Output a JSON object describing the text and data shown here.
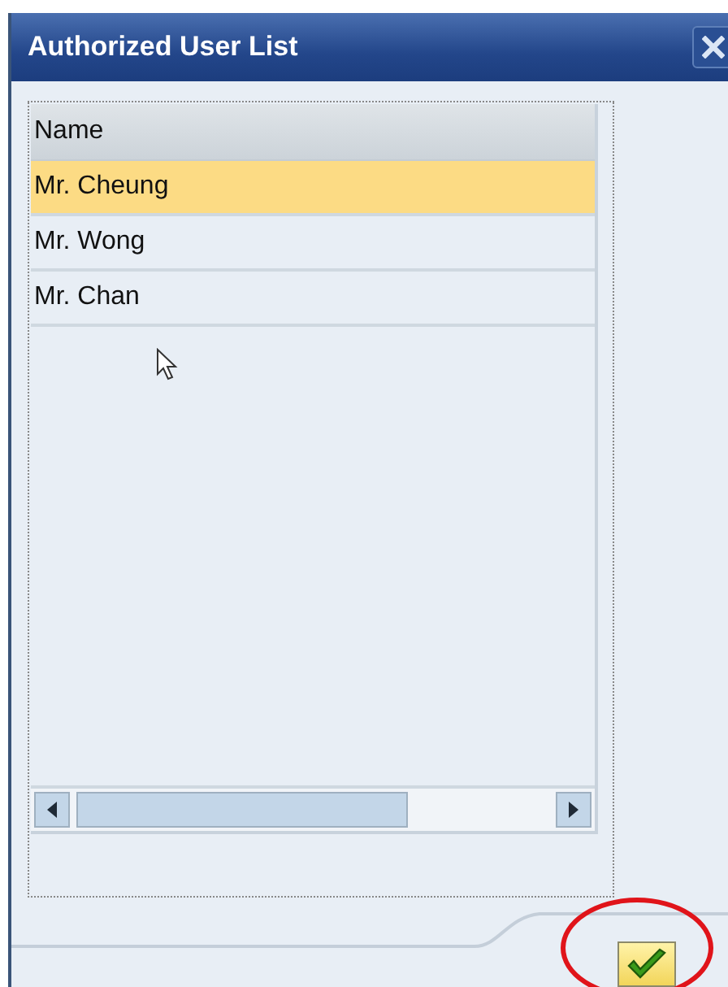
{
  "window": {
    "title": "Authorized User List"
  },
  "table": {
    "columns": [
      "Name"
    ],
    "rows": [
      {
        "name": "Mr. Cheung",
        "selected": true
      },
      {
        "name": "Mr. Wong",
        "selected": false
      },
      {
        "name": "Mr. Chan",
        "selected": false
      }
    ]
  }
}
